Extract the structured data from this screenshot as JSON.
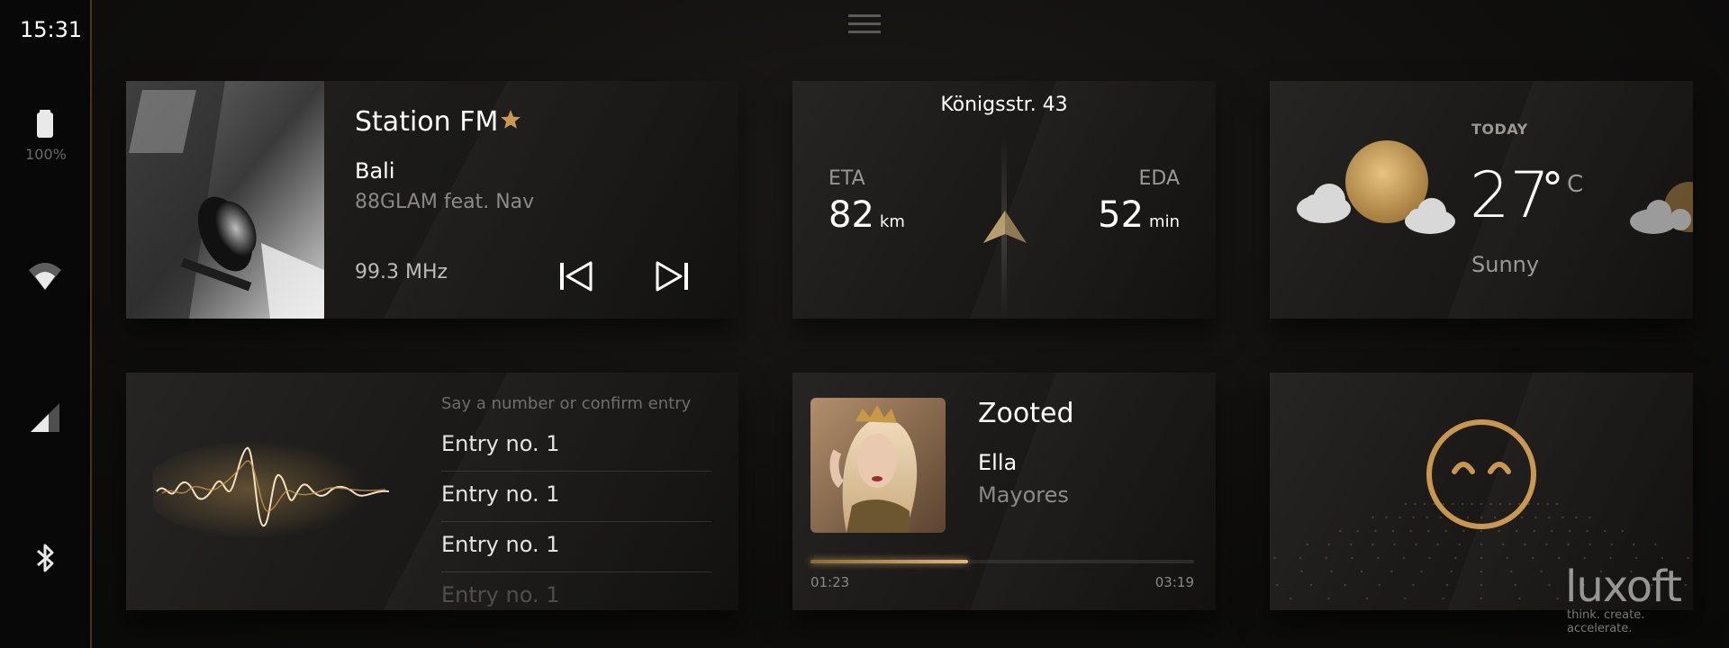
{
  "status_bar": {
    "time": "15:31",
    "battery_percent": "100%"
  },
  "radio": {
    "station": "Station FM",
    "song": "Bali",
    "artist": "88GLAM feat. Nav",
    "frequency": "99.3 MHz"
  },
  "navigation": {
    "address": "Königsstr. 43",
    "eta_label": "ETA",
    "eda_label": "EDA",
    "eta_value": "82",
    "eta_unit": "km",
    "eda_value": "52",
    "eda_unit": "min"
  },
  "weather": {
    "day": "TODAY",
    "temperature": "27",
    "degree_symbol": "°",
    "unit": "C",
    "condition": "Sunny"
  },
  "voice": {
    "hint": "Say a number or confirm entry",
    "entries": [
      "Entry no. 1",
      "Entry no. 1",
      "Entry no. 1",
      "Entry no. 1"
    ]
  },
  "music": {
    "title": "Zooted",
    "artist": "Ella",
    "album": "Mayores",
    "current_time": "01:23",
    "total_time": "03:19",
    "progress": 0.41
  },
  "brand": {
    "name": "luxoft",
    "tagline": "think. create. accelerate."
  },
  "colors": {
    "accent": "#c8964f",
    "background": "#0e0d0c",
    "panel": "#1b1a18"
  }
}
